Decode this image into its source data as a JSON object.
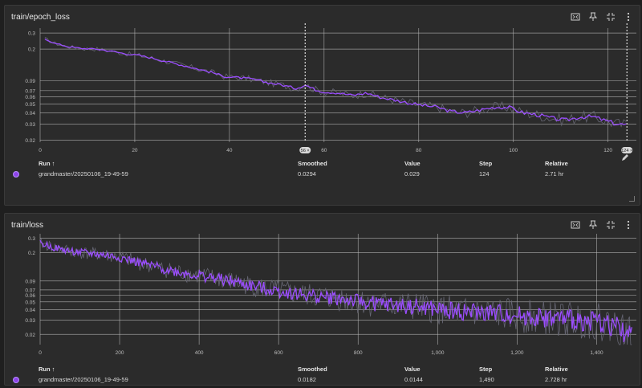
{
  "colors": {
    "series": "#9b4dff",
    "raw": "#6b6b7a",
    "grid": "#bdbdbd"
  },
  "cards": [
    {
      "title": "train/epoch_loss",
      "icons": [
        "fit-domain-icon",
        "pin-icon",
        "fullscreen-icon",
        "more-vert-icon"
      ],
      "table": {
        "headers": {
          "run": "Run ↑",
          "smoothed": "Smoothed",
          "value": "Value",
          "step": "Step",
          "relative": "Relative"
        },
        "row": {
          "run": "grandmaster/20250106_19-49-59",
          "smoothed": "0.0294",
          "value": "0.029",
          "step": "124",
          "relative": "2.71 hr"
        }
      },
      "cursor_labels": [
        "56 ×",
        "124 ×"
      ]
    },
    {
      "title": "train/loss",
      "icons": [
        "fit-domain-icon",
        "pin-icon",
        "fullscreen-icon",
        "more-vert-icon"
      ],
      "table": {
        "headers": {
          "run": "Run ↑",
          "smoothed": "Smoothed",
          "value": "Value",
          "step": "Step",
          "relative": "Relative"
        },
        "row": {
          "run": "grandmaster/20250106_19-49-59",
          "smoothed": "0.0182",
          "value": "0.0144",
          "step": "1,490",
          "relative": "2.728 hr"
        }
      }
    }
  ],
  "chart_data": [
    {
      "type": "line",
      "title": "train/epoch_loss",
      "yscale": "log",
      "xlim": [
        0,
        126
      ],
      "ylim": [
        0.019,
        0.34
      ],
      "x_ticks": [
        0,
        20,
        40,
        60,
        80,
        100,
        120
      ],
      "x_tick_labels": [
        "0",
        "20",
        "40",
        "60",
        "80",
        "100",
        "120"
      ],
      "y_ticks": [
        0.02,
        0.03,
        0.04,
        0.05,
        0.06,
        0.07,
        0.09,
        0.2,
        0.3
      ],
      "y_tick_labels": [
        "0.02",
        "0.03",
        "0.04",
        "0.05",
        "0.06",
        "0.07",
        "0.09",
        "0.2",
        "0.3"
      ],
      "cursors": [
        56,
        124
      ],
      "series": [
        {
          "name": "grandmaster/20250106_19-49-59",
          "x": [
            1,
            3,
            6,
            9,
            12,
            15,
            18,
            21,
            24,
            27,
            30,
            33,
            36,
            39,
            42,
            45,
            48,
            51,
            54,
            56,
            58,
            60,
            63,
            66,
            69,
            72,
            75,
            78,
            81,
            84,
            87,
            90,
            93,
            96,
            99,
            102,
            105,
            108,
            111,
            114,
            117,
            120,
            122,
            124
          ],
          "values": [
            0.26,
            0.232,
            0.212,
            0.203,
            0.2,
            0.19,
            0.178,
            0.17,
            0.158,
            0.145,
            0.133,
            0.122,
            0.112,
            0.1,
            0.097,
            0.093,
            0.086,
            0.081,
            0.074,
            0.081,
            0.072,
            0.068,
            0.066,
            0.062,
            0.066,
            0.059,
            0.055,
            0.051,
            0.048,
            0.046,
            0.041,
            0.04,
            0.043,
            0.046,
            0.046,
            0.04,
            0.038,
            0.035,
            0.033,
            0.036,
            0.036,
            0.032,
            0.03,
            0.0294
          ]
        }
      ]
    },
    {
      "type": "line",
      "title": "train/loss",
      "yscale": "log",
      "xlim": [
        0,
        1500
      ],
      "ylim": [
        0.015,
        0.34
      ],
      "x_ticks": [
        0,
        200,
        400,
        600,
        800,
        1000,
        1200,
        1400
      ],
      "x_tick_labels": [
        "0",
        "200",
        "400",
        "600",
        "800",
        "1,000",
        "1,200",
        "1,400"
      ],
      "y_ticks": [
        0.02,
        0.03,
        0.04,
        0.05,
        0.06,
        0.07,
        0.09,
        0.2,
        0.3
      ],
      "y_tick_labels": [
        "0.02",
        "0.03",
        "0.04",
        "0.05",
        "0.06",
        "0.07",
        "0.09",
        "0.2",
        "0.3"
      ],
      "series": [
        {
          "name": "grandmaster/20250106_19-49-59",
          "x": [
            0,
            50,
            100,
            150,
            200,
            250,
            300,
            350,
            400,
            450,
            500,
            550,
            600,
            650,
            700,
            750,
            800,
            850,
            900,
            950,
            1000,
            1050,
            1100,
            1150,
            1200,
            1250,
            1300,
            1350,
            1400,
            1450,
            1490
          ],
          "values": [
            0.26,
            0.22,
            0.2,
            0.19,
            0.175,
            0.15,
            0.13,
            0.115,
            0.105,
            0.095,
            0.085,
            0.075,
            0.068,
            0.062,
            0.058,
            0.055,
            0.05,
            0.047,
            0.045,
            0.043,
            0.04,
            0.038,
            0.037,
            0.036,
            0.034,
            0.032,
            0.031,
            0.03,
            0.029,
            0.025,
            0.0182
          ]
        }
      ]
    }
  ]
}
